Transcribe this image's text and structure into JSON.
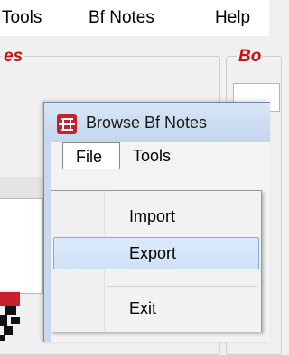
{
  "main_menu": {
    "items": [
      {
        "label": "Tools"
      },
      {
        "label": "Bf Notes"
      },
      {
        "label": "Help"
      }
    ]
  },
  "groups": {
    "left_legend": "es",
    "right_legend": "Bo"
  },
  "dialog": {
    "title": "Browse Bf Notes",
    "icon": "bf-notes-app-icon",
    "menu": {
      "file": "File",
      "tools": "Tools"
    }
  },
  "dropdown": {
    "items": [
      {
        "label": "Import",
        "highlighted": false
      },
      {
        "label": "Export",
        "highlighted": true
      },
      {
        "label": "Exit",
        "highlighted": false
      }
    ]
  },
  "colors": {
    "legend_red": "#cc1010",
    "highlight_bg": "#cfe1f7",
    "highlight_border": "#7eaee3",
    "icon_red": "#c8202a"
  }
}
